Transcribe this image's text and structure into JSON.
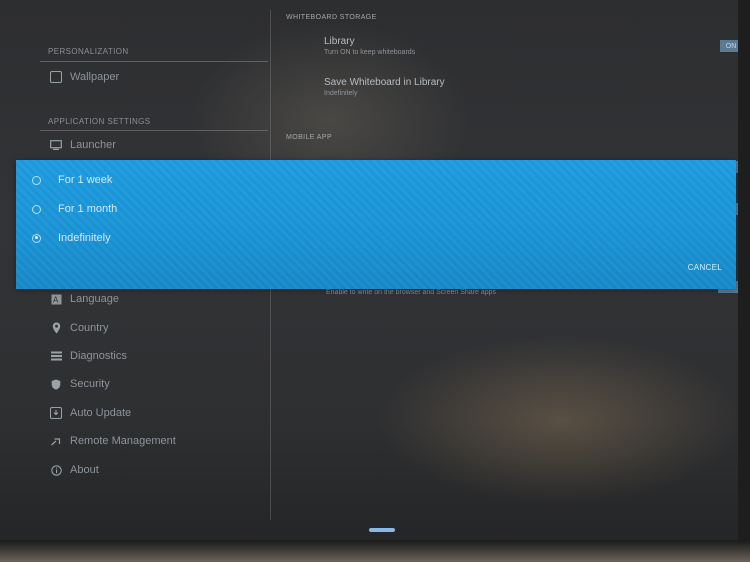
{
  "sidebar": {
    "top_cut_label": "",
    "sections": [
      {
        "title": "PERSONALIZATION",
        "items": [
          {
            "label": "Wallpaper",
            "icon": "wallpaper-icon"
          }
        ]
      },
      {
        "title": "APPLICATION SETTINGS",
        "items": [
          {
            "label": "Launcher",
            "icon": "monitor-icon"
          }
        ]
      }
    ],
    "lower_items": [
      {
        "label": "Language",
        "icon": "language-icon"
      },
      {
        "label": "Country",
        "icon": "location-pin-icon"
      },
      {
        "label": "Diagnostics",
        "icon": "list-icon"
      },
      {
        "label": "Security",
        "icon": "shield-icon"
      },
      {
        "label": "Auto Update",
        "icon": "update-icon"
      },
      {
        "label": "Remote Management",
        "icon": "remote-icon"
      },
      {
        "label": "About",
        "icon": "info-icon"
      }
    ]
  },
  "content": {
    "whiteboard_storage": {
      "title": "WHITEBOARD STORAGE",
      "library": {
        "title": "Library",
        "subtitle": "Turn ON to keep whiteboards",
        "toggle": "ON"
      },
      "save_in_library": {
        "title": "Save Whiteboard in Library",
        "subtitle": "Indefinitely"
      }
    },
    "mobile_app": {
      "title": "MOBILE APP"
    },
    "faint_row_text": "Enable to write on the browser and Screen Share apps"
  },
  "dialog": {
    "options": [
      {
        "label": "For 1 week",
        "selected": false
      },
      {
        "label": "For 1 month",
        "selected": false
      },
      {
        "label": "Indefinitely",
        "selected": true
      }
    ],
    "cancel_label": "CANCEL"
  },
  "colors": {
    "dialog_blue": "#1a94d6",
    "toggle_blue": "#5d7a94"
  }
}
